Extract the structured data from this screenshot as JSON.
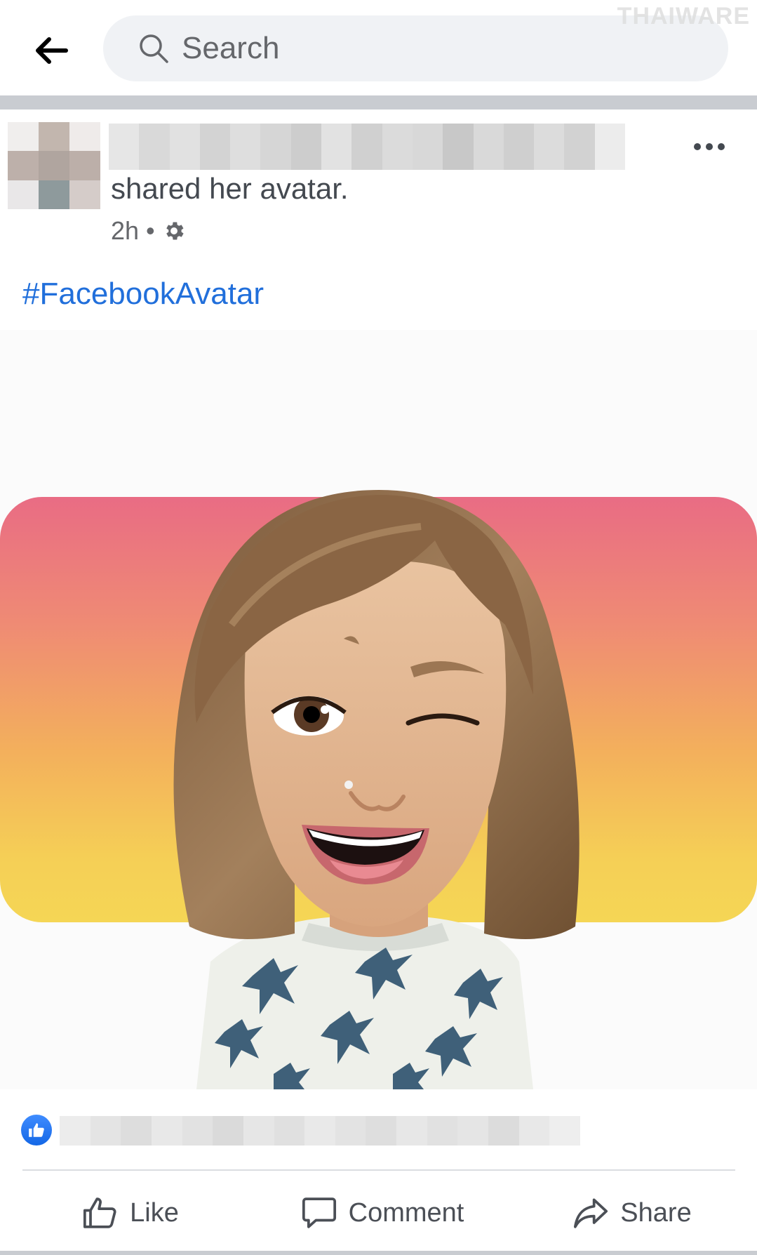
{
  "header": {
    "search_placeholder": "Search",
    "watermark": "THAIWARE"
  },
  "post": {
    "action_text": "shared her avatar.",
    "time": "2h",
    "dot": "•",
    "hashtag": "#FacebookAvatar"
  },
  "actions": {
    "like": "Like",
    "comment": "Comment",
    "share": "Share"
  },
  "colors": {
    "hashtag_blue": "#216fdb",
    "like_blue": "#1467e6",
    "gradient_top": "#e96c84",
    "gradient_bottom": "#f5d655"
  }
}
